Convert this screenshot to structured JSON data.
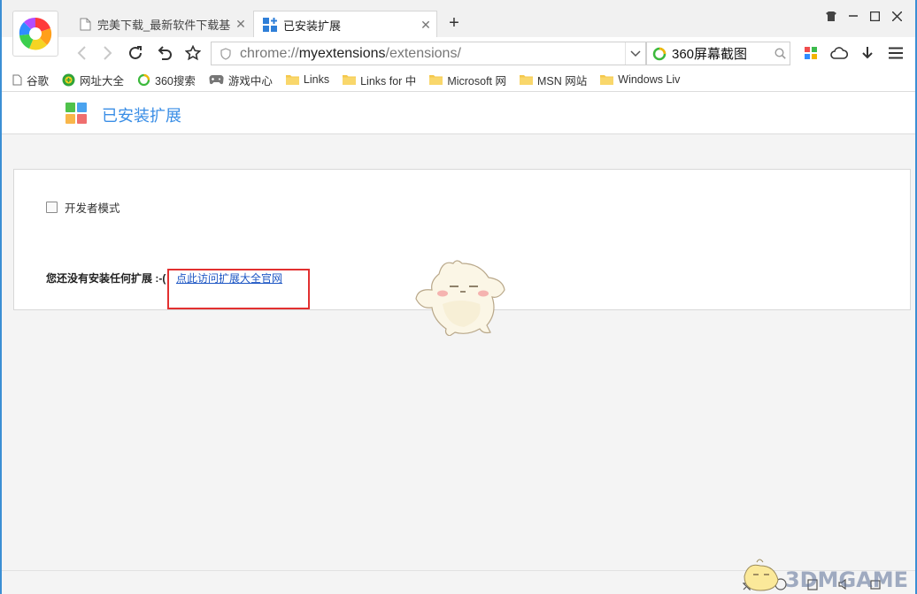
{
  "colors": {
    "accent": "#3a8ee6",
    "link": "#1d56c4",
    "highlight_box": "#e23030",
    "window_border": "#3b8fd4"
  },
  "tabs": [
    {
      "title": "完美下载_最新软件下载基地",
      "icon": "page-icon",
      "active": false
    },
    {
      "title": "已安装扩展",
      "icon": "extensions-grid-icon",
      "active": true
    }
  ],
  "new_tab_label": "+",
  "address": {
    "scheme": "chrome://",
    "host": "myextensions",
    "path": "/extensions/"
  },
  "search": {
    "value": "360屏幕截图"
  },
  "bookmarks": [
    {
      "label": "谷歌",
      "icon": "page-icon"
    },
    {
      "label": "网址大全",
      "icon": "url-hub-icon"
    },
    {
      "label": "360搜索",
      "icon": "360-search-icon"
    },
    {
      "label": "游戏中心",
      "icon": "gamepad-icon"
    },
    {
      "label": "Links",
      "icon": "folder-icon"
    },
    {
      "label": "Links for 中",
      "icon": "folder-icon"
    },
    {
      "label": "Microsoft 网",
      "icon": "folder-icon"
    },
    {
      "label": "MSN 网站",
      "icon": "folder-icon"
    },
    {
      "label": "Windows Liv",
      "icon": "folder-icon"
    }
  ],
  "page": {
    "title": "已安装扩展",
    "dev_mode_label": "开发者模式",
    "empty_message": "您还没有安装任何扩展 :-(",
    "visit_link": "点此访问扩展大全官网"
  },
  "watermark": {
    "text": "3DMGAME"
  }
}
